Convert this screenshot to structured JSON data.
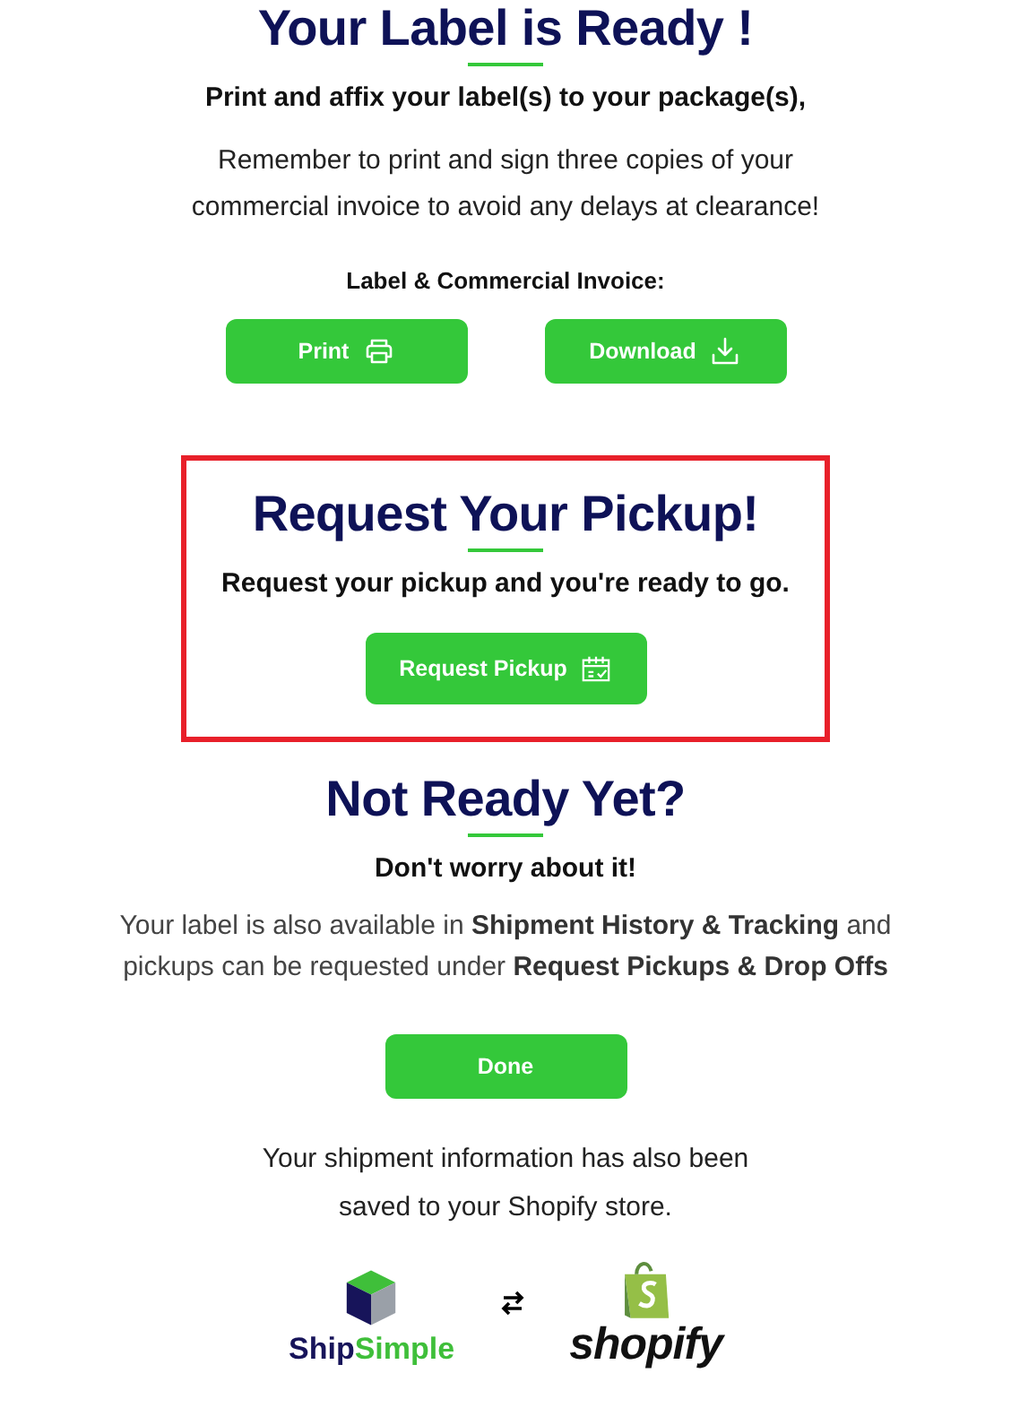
{
  "label_section": {
    "title": "Your Label is Ready !",
    "subtitle": "Print and affix your label(s) to your package(s),",
    "message": "Remember to print and sign three copies of your commercial invoice to avoid any delays at clearance!",
    "documents_heading": "Label & Commercial Invoice:",
    "buttons": [
      {
        "label": "Print"
      },
      {
        "label": "Download"
      }
    ]
  },
  "pickup_section": {
    "highlighted": true,
    "title": "Request Your Pickup!",
    "subtitle": "Request your pickup and you're ready to go.",
    "button": {
      "label": "Request Pickup"
    }
  },
  "not_ready_section": {
    "title": "Not Ready Yet?",
    "subtitle": "Don't worry about it!",
    "message": "Your label is also available in **Shipment History & Tracking** and pickups can be requested under **Request Pickups & Drop Offs**",
    "button": {
      "label": "Done"
    }
  },
  "footer": {
    "message": "Your shipment information has also been saved to your Shopify store.",
    "logos": {
      "left_first": "Ship",
      "left_second": "Simple",
      "right": "shopify"
    }
  }
}
